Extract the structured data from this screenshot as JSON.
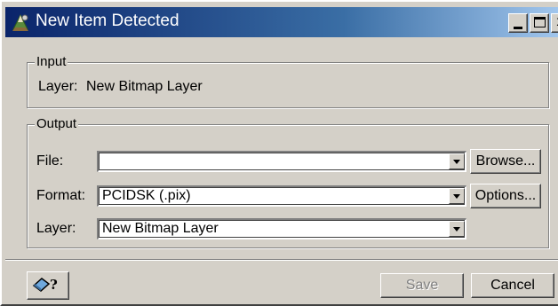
{
  "window": {
    "title": "New Item Detected",
    "icon": "pci-geomatica-app-icon",
    "controls": {
      "minimize": "_",
      "maximize": "□",
      "close": "x"
    }
  },
  "input_group": {
    "legend": "Input",
    "layer_label": "Layer:",
    "layer_value": "New Bitmap Layer"
  },
  "output_group": {
    "legend": "Output",
    "file": {
      "label": "File:",
      "value": ""
    },
    "format": {
      "label": "Format:",
      "value": "PCIDSK (.pix)"
    },
    "layer": {
      "label": "Layer:",
      "value": "New Bitmap Layer"
    },
    "browse_label": "Browse...",
    "options_label": "Options..."
  },
  "footer": {
    "help_icon": "context-help-icon",
    "save_label": "Save",
    "save_enabled": false,
    "cancel_label": "Cancel"
  }
}
